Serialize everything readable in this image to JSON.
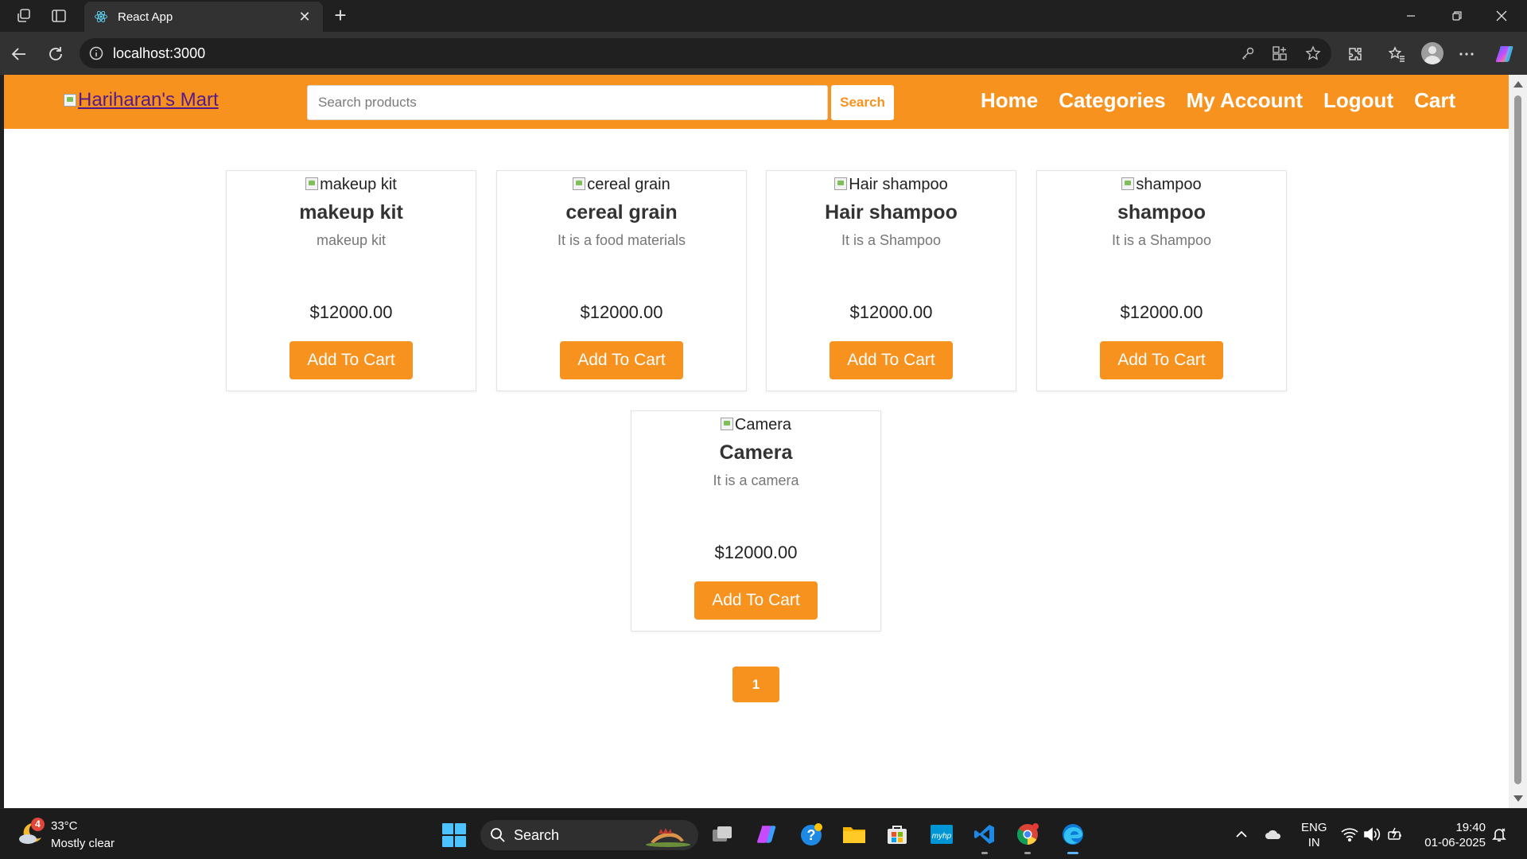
{
  "browser": {
    "tab_title": "React App",
    "new_tab_symbol": "+",
    "close_tab_symbol": "✕",
    "url": "localhost:3000"
  },
  "app": {
    "brand": "Hariharan's Mart",
    "search_placeholder": "Search products",
    "search_button": "Search",
    "nav": [
      "Home",
      "Categories",
      "My Account",
      "Logout",
      "Cart"
    ],
    "accent_color": "#f7921e"
  },
  "products": [
    {
      "image_alt": "makeup kit",
      "name": "makeup kit",
      "description": "makeup kit",
      "price": "$12000.00",
      "button": "Add To Cart"
    },
    {
      "image_alt": "cereal grain",
      "name": "cereal grain",
      "description": "It is a food materials",
      "price": "$12000.00",
      "button": "Add To Cart"
    },
    {
      "image_alt": "Hair shampoo",
      "name": "Hair shampoo",
      "description": "It is a Shampoo",
      "price": "$12000.00",
      "button": "Add To Cart"
    },
    {
      "image_alt": "shampoo",
      "name": "shampoo",
      "description": "It is a Shampoo",
      "price": "$12000.00",
      "button": "Add To Cart"
    },
    {
      "image_alt": "Camera",
      "name": "Camera",
      "description": "It is a camera",
      "price": "$12000.00",
      "button": "Add To Cart"
    }
  ],
  "pagination": {
    "current": "1"
  },
  "taskbar": {
    "weather_badge": "4",
    "weather_temp": "33°C",
    "weather_desc": "Mostly clear",
    "search_label": "Search",
    "lang_line1": "ENG",
    "lang_line2": "IN",
    "time": "19:40",
    "date": "01-06-2025"
  }
}
